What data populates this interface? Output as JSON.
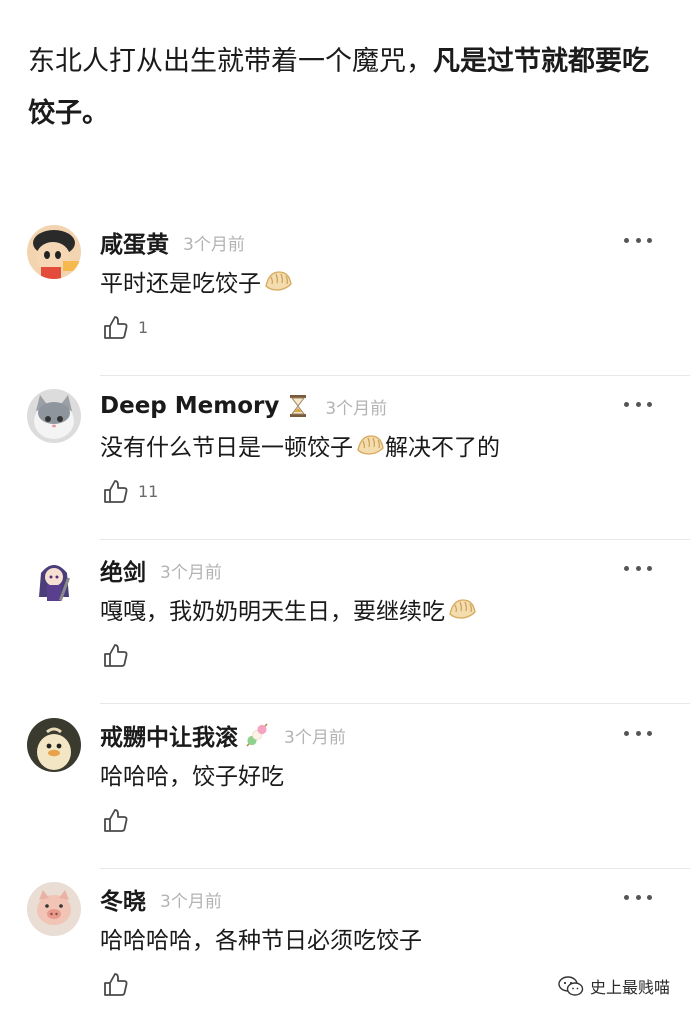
{
  "post": {
    "text_normal": "东北人打从出生就带着一个魔咒，",
    "text_bold": "凡是过节就都要吃饺子。"
  },
  "comments": [
    {
      "name": "咸蛋黄",
      "time": "3个月前",
      "text_before": "平时还是吃饺子",
      "text_after": "",
      "likes": "1",
      "avatar_icon": "cartoon-boy-avatar",
      "name_badge": ""
    },
    {
      "name": "Deep Memory",
      "time": "3个月前",
      "text_before": "没有什么节日是一顿饺子",
      "text_after": "解决不了的",
      "likes": "11",
      "avatar_icon": "cat-avatar",
      "name_badge": "hourglass-icon"
    },
    {
      "name": "绝剑",
      "time": "3个月前",
      "text_before": "嘎嘎，我奶奶明天生日，要继续吃",
      "text_after": "",
      "likes": "",
      "avatar_icon": "anime-girl-avatar",
      "name_badge": ""
    },
    {
      "name": "戒嬲中让我滚",
      "time": "3个月前",
      "text_before": "哈哈哈，饺子好吃",
      "text_after": "",
      "likes": "",
      "avatar_icon": "duck-avatar",
      "name_badge": "dango-icon"
    },
    {
      "name": "冬晓",
      "time": "3个月前",
      "text_before": "哈哈哈哈，各种节日必须吃饺子",
      "text_after": "",
      "likes": "",
      "avatar_icon": "pig-avatar",
      "name_badge": ""
    }
  ],
  "icons": {
    "like": "thumbs-up-icon",
    "more": "more-dots-icon",
    "emoji": "dumpling-emoji",
    "watermark": "wechat-logo-icon"
  },
  "watermark": {
    "text": "史上最贱喵"
  },
  "colors": {
    "time": "#b3b3b3",
    "text": "#1a1a1a",
    "divider": "#e8e8e8"
  }
}
